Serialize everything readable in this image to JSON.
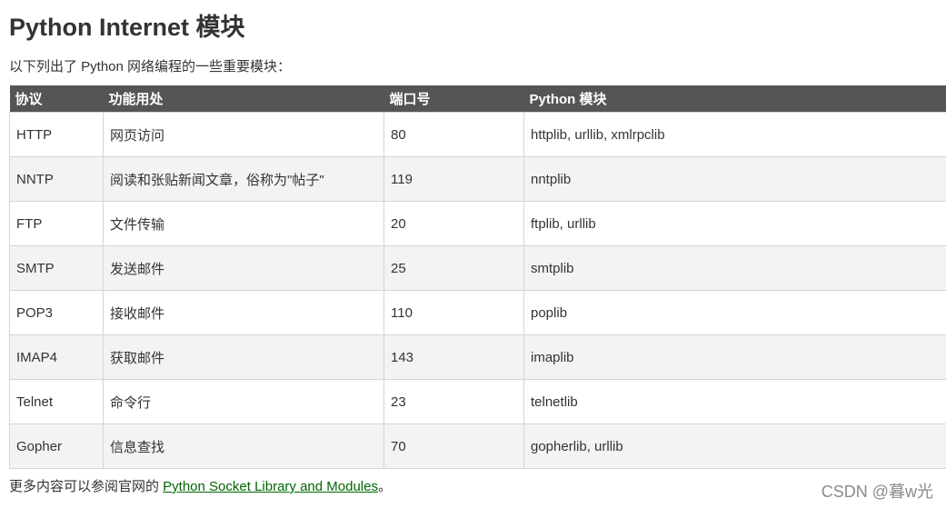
{
  "page": {
    "title": "Python Internet 模块",
    "intro": "以下列出了 Python 网络编程的一些重要模块："
  },
  "table": {
    "headers": [
      "协议",
      "功能用处",
      "端口号",
      "Python 模块"
    ],
    "rows": [
      [
        "HTTP",
        "网页访问",
        "80",
        "httplib, urllib, xmlrpclib"
      ],
      [
        "NNTP",
        "阅读和张贴新闻文章，俗称为\"帖子\"",
        "119",
        "nntplib"
      ],
      [
        "FTP",
        "文件传输",
        "20",
        "ftplib, urllib"
      ],
      [
        "SMTP",
        "发送邮件",
        "25",
        "smtplib"
      ],
      [
        "POP3",
        "接收邮件",
        "110",
        "poplib"
      ],
      [
        "IMAP4",
        "获取邮件",
        "143",
        "imaplib"
      ],
      [
        "Telnet",
        "命令行",
        "23",
        "telnetlib"
      ],
      [
        "Gopher",
        "信息查找",
        "70",
        "gopherlib, urllib"
      ]
    ]
  },
  "footer": {
    "prefix": "更多内容可以参阅官网的 ",
    "link_text": "Python Socket Library and Modules",
    "suffix": "。"
  },
  "watermark": "CSDN @暮w光",
  "colors": {
    "header_bg": "#555555",
    "alt_row_bg": "#f3f3f1",
    "link": "#006600",
    "text": "#333333"
  }
}
